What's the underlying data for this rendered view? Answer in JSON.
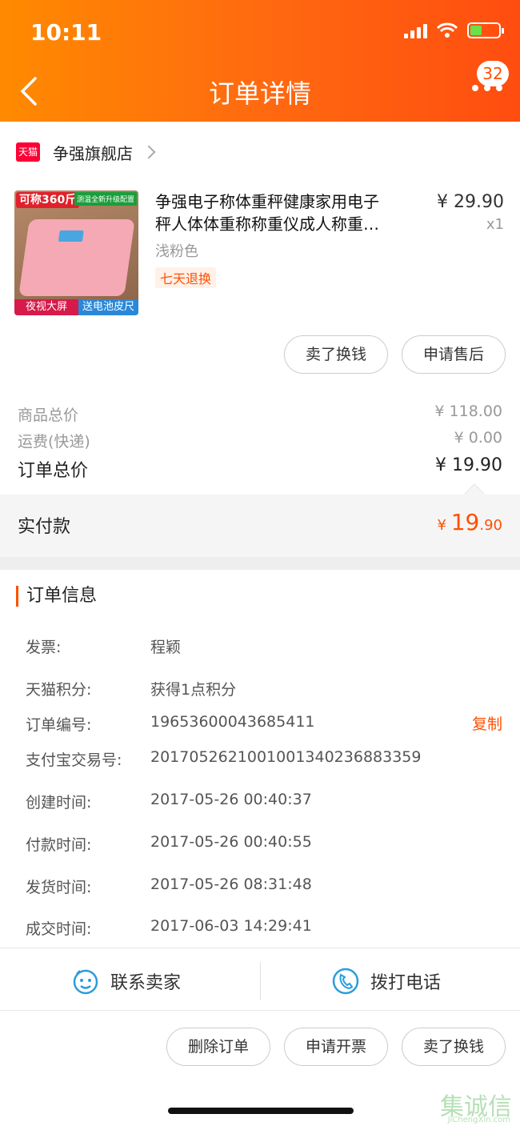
{
  "status_bar": {
    "time": "10:11"
  },
  "header": {
    "title": "订单详情",
    "badge_count": "32"
  },
  "store": {
    "logo_text": "天猫",
    "name": "争强旗舰店"
  },
  "product": {
    "image_tags": {
      "top_left": "可称360斤",
      "top_right": "测温全新升级配置",
      "bottom_left": "夜视大屏",
      "bottom_right": "送电池皮尺"
    },
    "title_line1": "争强电子称体重秤健康家用电子",
    "title_line2": "秤人体体重称称重仪成人称重…",
    "price": "¥ 29.90",
    "qty": "x1",
    "variant": "浅粉色",
    "return_tag": "七天退换"
  },
  "item_actions": {
    "sell": "卖了换钱",
    "after_sale": "申请售后"
  },
  "totals": {
    "goods_label": "商品总价",
    "goods_value": "¥ 118.00",
    "shipping_label": "运费(快递)",
    "shipping_value": "¥ 0.00",
    "order_label": "订单总价",
    "order_value": "¥ 19.90",
    "paid_label": "实付款",
    "paid_symbol": "¥ ",
    "paid_int": "19",
    "paid_dec": ".90"
  },
  "order_info": {
    "heading": "订单信息",
    "copy_label": "复制",
    "rows": [
      {
        "label": "发票:",
        "value": "程颖"
      },
      {
        "label": "天猫积分:",
        "value": "获得1点积分"
      },
      {
        "label": "订单编号:",
        "value": "19653600043685411"
      },
      {
        "label": "支付宝交易号:",
        "value": "2017052621001001340236883359"
      },
      {
        "label": "创建时间:",
        "value": "2017-05-26 00:40:37"
      },
      {
        "label": "付款时间:",
        "value": "2017-05-26 00:40:55"
      },
      {
        "label": "发货时间:",
        "value": "2017-05-26 08:31:48"
      },
      {
        "label": "成交时间:",
        "value": "2017-06-03 14:29:41"
      }
    ]
  },
  "contact": {
    "seller": "联系卖家",
    "call": "拨打电话"
  },
  "bottom_actions": {
    "delete": "删除订单",
    "invoice": "申请开票",
    "sell": "卖了换钱"
  },
  "watermark": {
    "main": "集诚信",
    "sub": "JiChengXin.com"
  },
  "colors": {
    "accent": "#ff5000",
    "header_start": "#ff8a00",
    "header_end": "#ff4d10"
  }
}
